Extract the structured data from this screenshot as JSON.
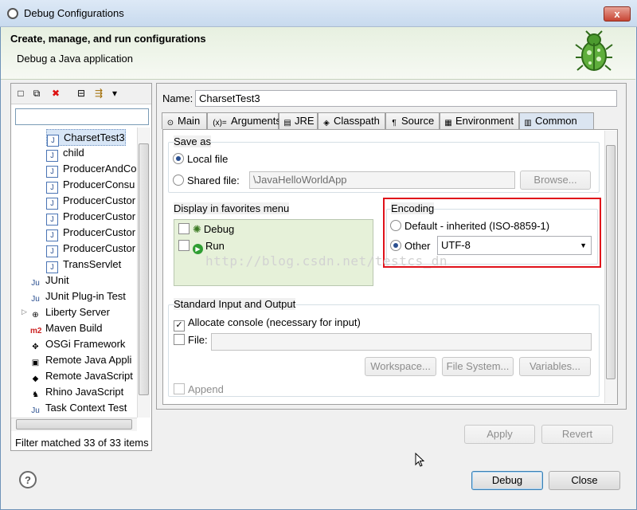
{
  "window": {
    "title": "Debug Configurations",
    "close_glyph": "x"
  },
  "header": {
    "title": "Create, manage, and run configurations",
    "subtitle": "Debug a Java application"
  },
  "left": {
    "toolbar": [
      {
        "icon": "new-config-icon",
        "glyph": "□"
      },
      {
        "icon": "duplicate-icon",
        "glyph": "⧉"
      },
      {
        "icon": "delete-icon",
        "glyph": "✖"
      },
      {
        "icon": "collapse-all-icon",
        "glyph": "⊟"
      },
      {
        "icon": "filter-icon",
        "glyph": "⇶"
      },
      {
        "icon": "dropdown-icon",
        "glyph": "▾"
      }
    ],
    "filter_value": "",
    "tree": [
      {
        "label": "CharsetTest3",
        "icon": "J",
        "selected": true
      },
      {
        "label": "child",
        "icon": "J"
      },
      {
        "label": "ProducerAndCo",
        "icon": "J"
      },
      {
        "label": "ProducerConsu",
        "icon": "J"
      },
      {
        "label": "ProducerCustor",
        "icon": "J"
      },
      {
        "label": "ProducerCustor",
        "icon": "J"
      },
      {
        "label": "ProducerCustor",
        "icon": "J"
      },
      {
        "label": "ProducerCustor",
        "icon": "J"
      },
      {
        "label": "TransServlet",
        "icon": "J"
      },
      {
        "label": "JUnit",
        "icon": "Ju"
      },
      {
        "label": "JUnit Plug-in Test",
        "icon": "Ju"
      },
      {
        "label": "Liberty Server",
        "icon": "⊕"
      },
      {
        "label": "Maven Build",
        "icon": "m2"
      },
      {
        "label": "OSGi Framework",
        "icon": "✥"
      },
      {
        "label": "Remote Java Appli",
        "icon": "▣"
      },
      {
        "label": "Remote JavaScript",
        "icon": "◆"
      },
      {
        "label": "Rhino JavaScript",
        "icon": "♞"
      },
      {
        "label": "Task Context Test",
        "icon": "Ju"
      }
    ],
    "filter_status": "Filter matched 33 of 33 items"
  },
  "right": {
    "name_label": "Name:",
    "name_value": "CharsetTest3",
    "tabs": [
      {
        "label": "Main",
        "icon": "main-tab-icon",
        "glyph": "⊙"
      },
      {
        "label": "Arguments",
        "icon": "arguments-tab-icon",
        "glyph": "(x)="
      },
      {
        "label": "JRE",
        "icon": "jre-tab-icon",
        "glyph": "▤"
      },
      {
        "label": "Classpath",
        "icon": "classpath-tab-icon",
        "glyph": "◈"
      },
      {
        "label": "Source",
        "icon": "source-tab-icon",
        "glyph": "¶"
      },
      {
        "label": "Environment",
        "icon": "environment-tab-icon",
        "glyph": "▦"
      },
      {
        "label": "Common",
        "icon": "common-tab-icon",
        "glyph": "▥",
        "active": true
      }
    ],
    "save_as": {
      "label": "Save as",
      "local": "Local file",
      "shared": "Shared file:",
      "shared_value": "\\JavaHelloWorldApp",
      "browse": "Browse..."
    },
    "favorites": {
      "label": "Display in favorites menu",
      "items": [
        "Debug",
        "Run"
      ]
    },
    "encoding": {
      "label": "Encoding",
      "default": "Default - inherited (ISO-8859-1)",
      "other": "Other",
      "other_value": "UTF-8"
    },
    "stdio": {
      "label": "Standard Input and Output",
      "allocate": "Allocate console (necessary for input)",
      "file": "File:",
      "workspace": "Workspace...",
      "filesystem": "File System...",
      "variables": "Variables...",
      "append": "Append"
    },
    "watermark": "http://blog.csdn.net/testcs_dn",
    "apply": "Apply",
    "revert": "Revert"
  },
  "footer": {
    "help_glyph": "?",
    "debug": "Debug",
    "close": "Close"
  }
}
